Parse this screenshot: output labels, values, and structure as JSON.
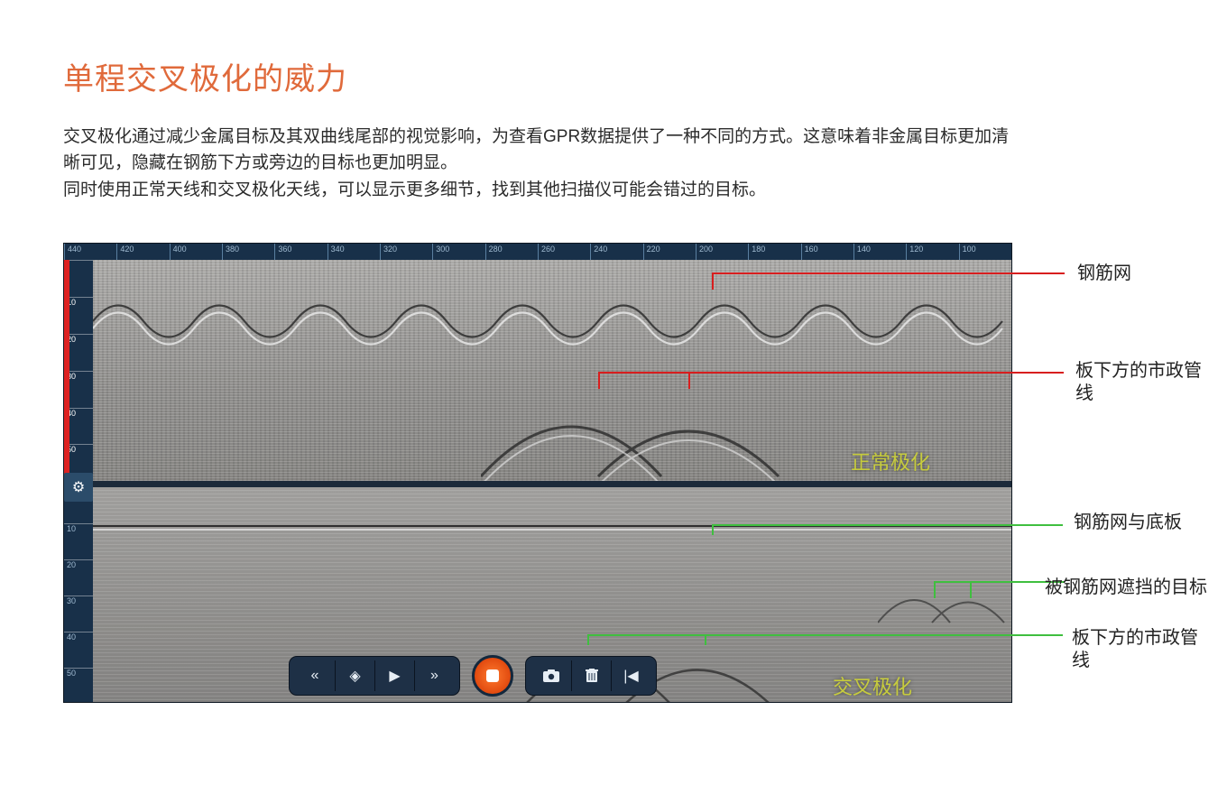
{
  "title": "单程交叉极化的威力",
  "description": "交叉极化通过减少金属目标及其双曲线尾部的视觉影响，为查看GPR数据提供了一种不同的方式。这意味着非金属目标更加清晰可见，隐藏在钢筋下方或旁边的目标也更加明显。\n同时使用正常天线和交叉极化天线，可以显示更多细节，找到其他扫描仪可能会错过的目标。",
  "ruler_values": [
    "440",
    "420",
    "400",
    "380",
    "360",
    "340",
    "320",
    "300",
    "280",
    "260",
    "240",
    "220",
    "200",
    "180",
    "160",
    "140",
    "120",
    "100"
  ],
  "v_ticks_top": [
    "",
    "10",
    "20",
    "30",
    "40",
    "50"
  ],
  "v_ticks_bot": [
    "",
    "10",
    "20",
    "30",
    "40",
    "50"
  ],
  "panels": {
    "normal_label": "正常极化",
    "cross_label": "交叉极化"
  },
  "callouts": {
    "c1": "钢筋网",
    "c2": "板下方的市政管线",
    "c3": "钢筋网与底板",
    "c4": "被钢筋网遮挡的目标",
    "c5": "板下方的市政管线"
  },
  "toolbar": {
    "rewind": "«",
    "center": "◈",
    "play": "▶",
    "fastfwd": "»",
    "camera": "camera",
    "trash": "trash",
    "skipback": "|◀"
  },
  "icons": {
    "gear": "⚙"
  }
}
